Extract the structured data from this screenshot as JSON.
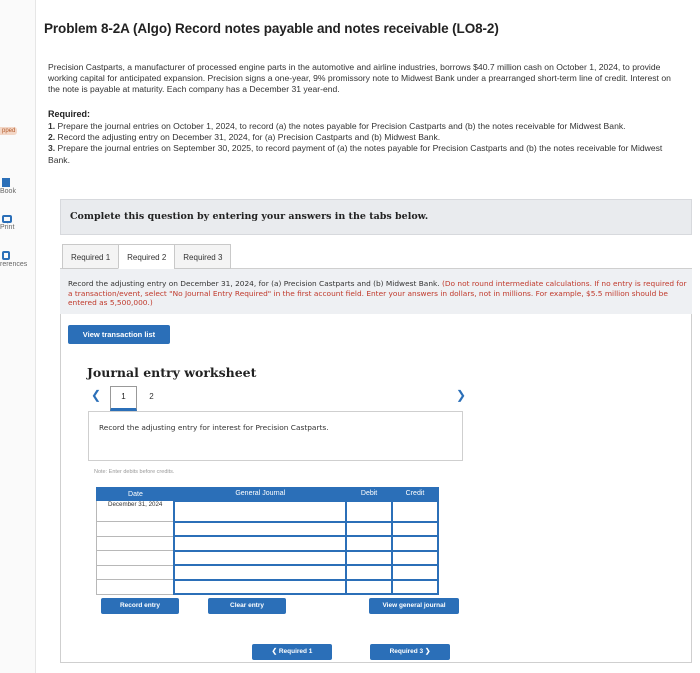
{
  "sidebar": {
    "skipped": "pped",
    "ebook": "Book",
    "print": "Print",
    "references": "rerences"
  },
  "problem": {
    "title": "Problem 8-2A (Algo) Record notes payable and notes receivable (LO8-2)",
    "intro": "Precision Castparts, a manufacturer of processed engine parts in the automotive and airline industries, borrows $40.7 million cash on October 1, 2024, to provide working capital for anticipated expansion. Precision signs a one-year, 9% promissory note to Midwest Bank under a prearranged short-term line of credit. Interest on the note is payable at maturity. Each company has a December 31 year-end.",
    "required_heading": "Required:",
    "requirements": [
      {
        "num": "1.",
        "text": " Prepare the journal entries on October 1, 2024, to record (a) the notes payable for Precision Castparts and (b) the notes receivable for Midwest Bank."
      },
      {
        "num": "2.",
        "text": " Record the adjusting entry on December 31, 2024, for (a) Precision Castparts and (b) Midwest Bank."
      },
      {
        "num": "3.",
        "text": " Prepare the journal entries on September 30, 2025, to record payment of (a) the notes payable for Precision Castparts and (b) the notes receivable for Midwest Bank."
      }
    ]
  },
  "complete_text": "Complete this question by entering your answers in the tabs below.",
  "tabs": [
    "Required 1",
    "Required 2",
    "Required 3"
  ],
  "instructions": {
    "main": "Record the adjusting entry on December 31, 2024, for (a) Precision Castparts and (b) Midwest Bank. ",
    "red": "(Do not round intermediate calculations. If no entry is required for a transaction/event, select \"No Journal Entry Required\" in the first account field. Enter your answers in dollars, not in millions. For example, $5.5 million should be entered as 5,500,000.)"
  },
  "view_transaction_list": "View transaction list",
  "worksheet": {
    "title": "Journal entry worksheet",
    "pages": [
      "1",
      "2"
    ],
    "entry_instruction": "Record the adjusting entry for interest for Precision Castparts.",
    "note": "Note: Enter debits before credits.",
    "columns": [
      "Date",
      "General Journal",
      "Debit",
      "Credit"
    ],
    "date_value": "December 31, 2024"
  },
  "buttons": {
    "record_entry": "Record entry",
    "clear_entry": "Clear entry",
    "view_general_journal": "View general journal",
    "prev_required": "Required 1",
    "next_required": "Required 3"
  },
  "colors": {
    "accent": "#2b6fb8",
    "instruction_red": "#c0392b"
  }
}
